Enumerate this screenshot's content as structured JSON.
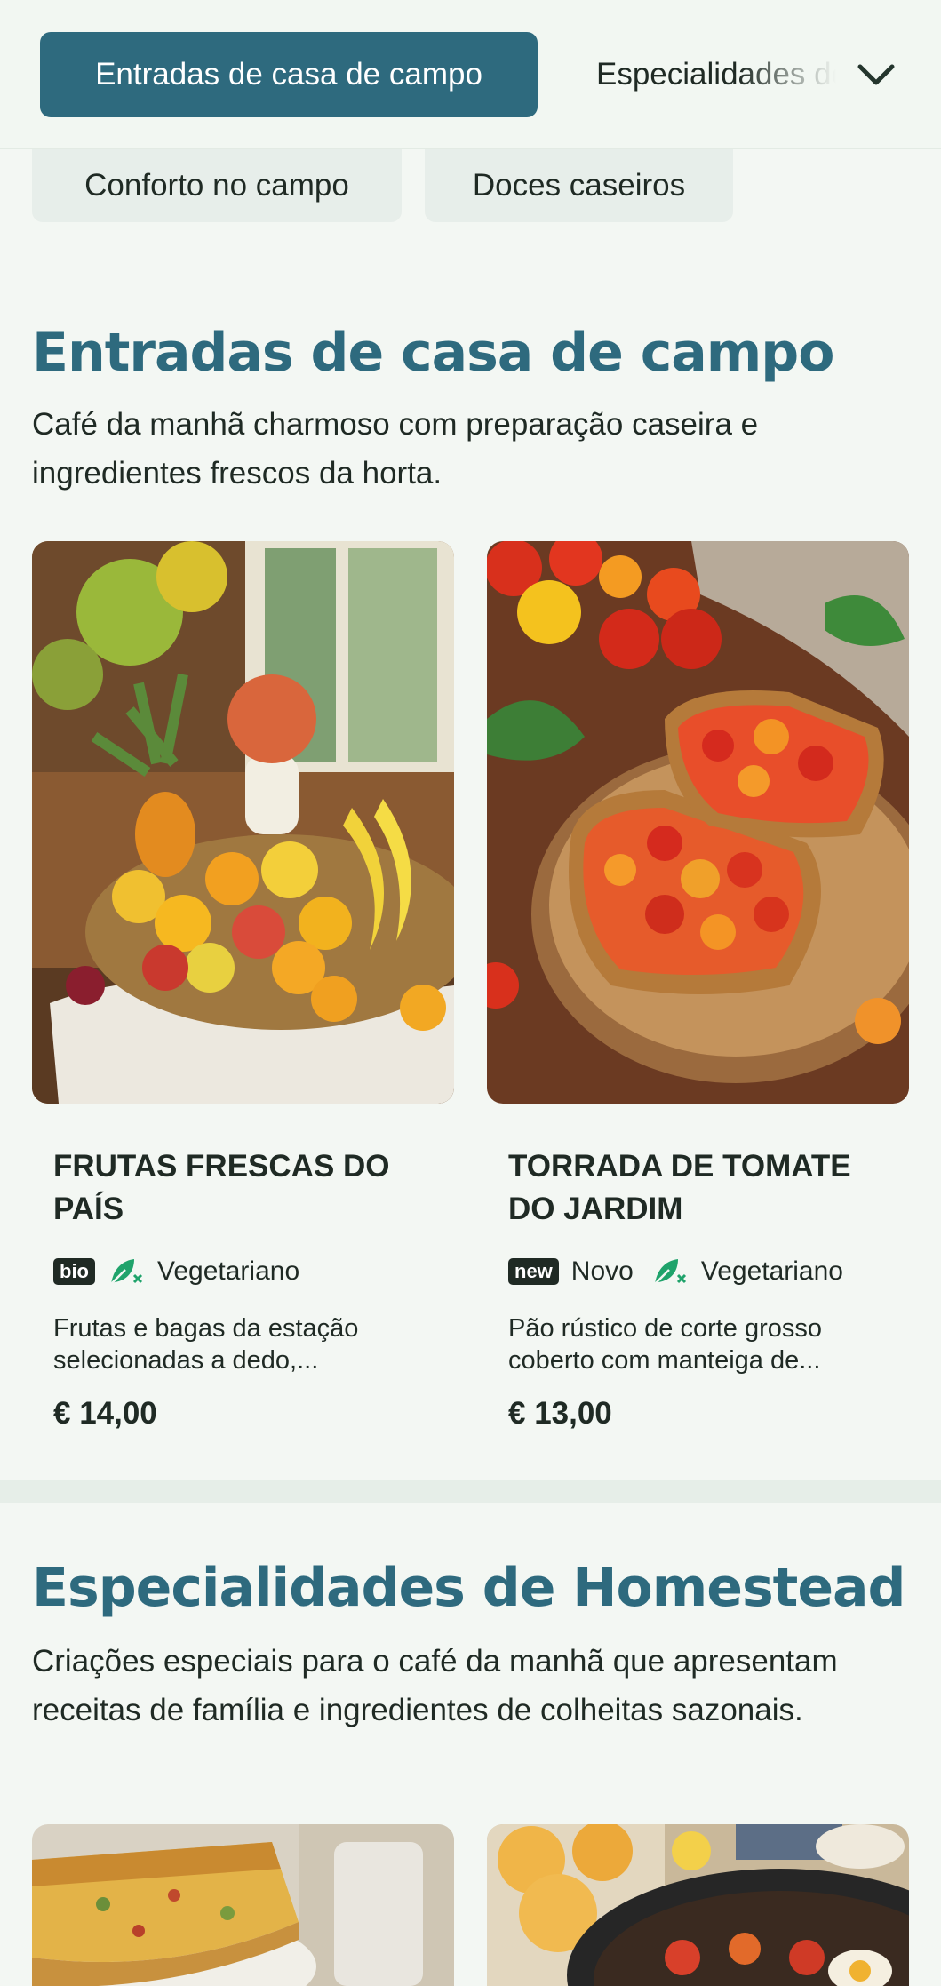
{
  "nav": {
    "active_tab": "Entradas de casa de campo",
    "next_tab": "Especialidades de Homestead",
    "chips": [
      "Conforto no campo",
      "Doces caseiros"
    ]
  },
  "sections": [
    {
      "title": "Entradas de casa de campo",
      "description": "Café da manhã charmoso com preparação caseira e ingredientes frescos da horta.",
      "items": [
        {
          "name": "FRUTAS FRESCAS DO PAÍS",
          "badge": "bio",
          "badge_label": "",
          "diet": "Vegetariano",
          "description": "Frutas e bagas da estação selecionadas a dedo,...",
          "price": "€ 14,00"
        },
        {
          "name": "TORRADA DE TOMATE DO JARDIM",
          "badge": "new",
          "badge_label": "Novo",
          "diet": "Vegetariano",
          "description": "Pão rústico de corte grosso coberto com manteiga de...",
          "price": "€ 13,00"
        }
      ]
    },
    {
      "title": "Especialidades de Homestead",
      "description": "Criações especiais para o café da manhã que apresentam receitas de família e ingredientes de colheitas sazonais."
    }
  ],
  "colors": {
    "accent": "#2e6a7e",
    "background": "#f3f7f3",
    "veg_icon": "#1fa36b",
    "text": "#1f2a24"
  },
  "icons": {
    "dropdown": "chevron-down-icon",
    "diet": "vegetarian-leaf-icon"
  }
}
